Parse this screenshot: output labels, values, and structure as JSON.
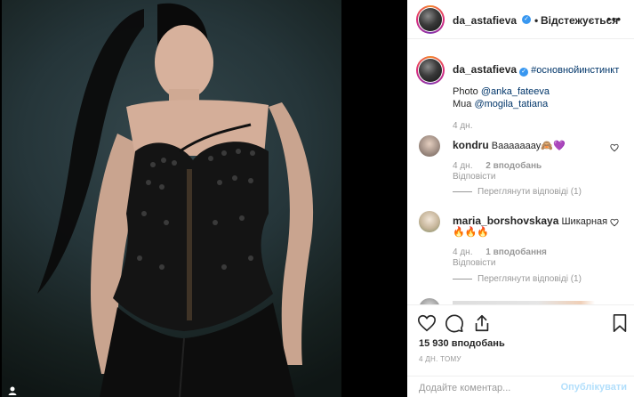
{
  "post": {
    "author": "da_astafieva",
    "follow_status": "Відстежується",
    "separator": "•",
    "more_icon": "•••",
    "caption": {
      "hashtag": "#основнойинстинкт",
      "photo_label": "Photo",
      "photo_credit": "@anka_fateeva",
      "mua_label": "Mua",
      "mua_credit": "@mogila_tatiana",
      "time": "4 дн."
    },
    "comments": [
      {
        "user": "kondru",
        "text": "Вааааааау🙈💜",
        "time": "4 дн.",
        "likes": "2 вподобань",
        "reply": "Відповісти",
        "view_replies": "Переглянути відповіді (1)"
      },
      {
        "user": "maria_borshovskaya",
        "text": "Шикарная",
        "text2": "🔥🔥🔥",
        "time": "4 дн.",
        "likes": "1 вподобання",
        "reply": "Відповісти",
        "view_replies": "Переглянути відповіді (1)"
      },
      {
        "user": "",
        "text": "",
        "partial": true
      }
    ],
    "likes_count": "15 930 вподобань",
    "posted_ago": "4 ДН. ТОМУ",
    "comment_placeholder": "Додайте коментар...",
    "publish_label": "Опублікувати"
  },
  "icons": {
    "like": "heart-icon",
    "comment": "comment-bubble-icon",
    "share": "share-icon",
    "save": "bookmark-icon",
    "verified": "verified-badge-icon"
  },
  "colors": {
    "accent": "#3897f0",
    "link": "#003569",
    "muted": "#999999",
    "publish_disabled": "#b2dffc"
  }
}
